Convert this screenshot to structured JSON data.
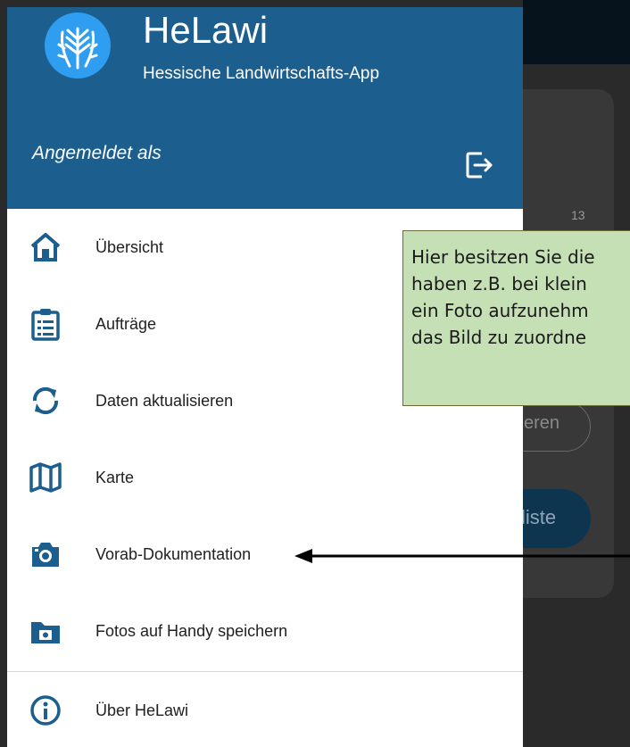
{
  "background": {
    "counter": "13",
    "pill_text": "eren",
    "button_text": "liste"
  },
  "drawer": {
    "app_title": "HeLawi",
    "app_subtitle": "Hessische Landwirtschafts-App",
    "logged_in_label": "Angemeldet als",
    "logo_icon": "wheat-logo",
    "logout_icon": "logout-icon",
    "header_color": "#1c5e8e",
    "items": [
      {
        "label": "Übersicht",
        "icon": "home-icon"
      },
      {
        "label": "Aufträge",
        "icon": "clipboard-list-icon"
      },
      {
        "label": "Daten aktualisieren",
        "icon": "sync-icon"
      },
      {
        "label": "Karte",
        "icon": "map-icon"
      },
      {
        "label": "Vorab-Dokumentation",
        "icon": "camera-icon"
      },
      {
        "label": "Fotos auf Handy speichern",
        "icon": "camera-folder-icon"
      },
      {
        "label": "Über HeLawi",
        "icon": "info-icon"
      }
    ]
  },
  "callout": {
    "text": "Hier besitzen Sie die\nhaben z.B. bei klein\nein Foto aufzunehm\ndas Bild zu zuordne",
    "color": "#c5e0b4"
  }
}
